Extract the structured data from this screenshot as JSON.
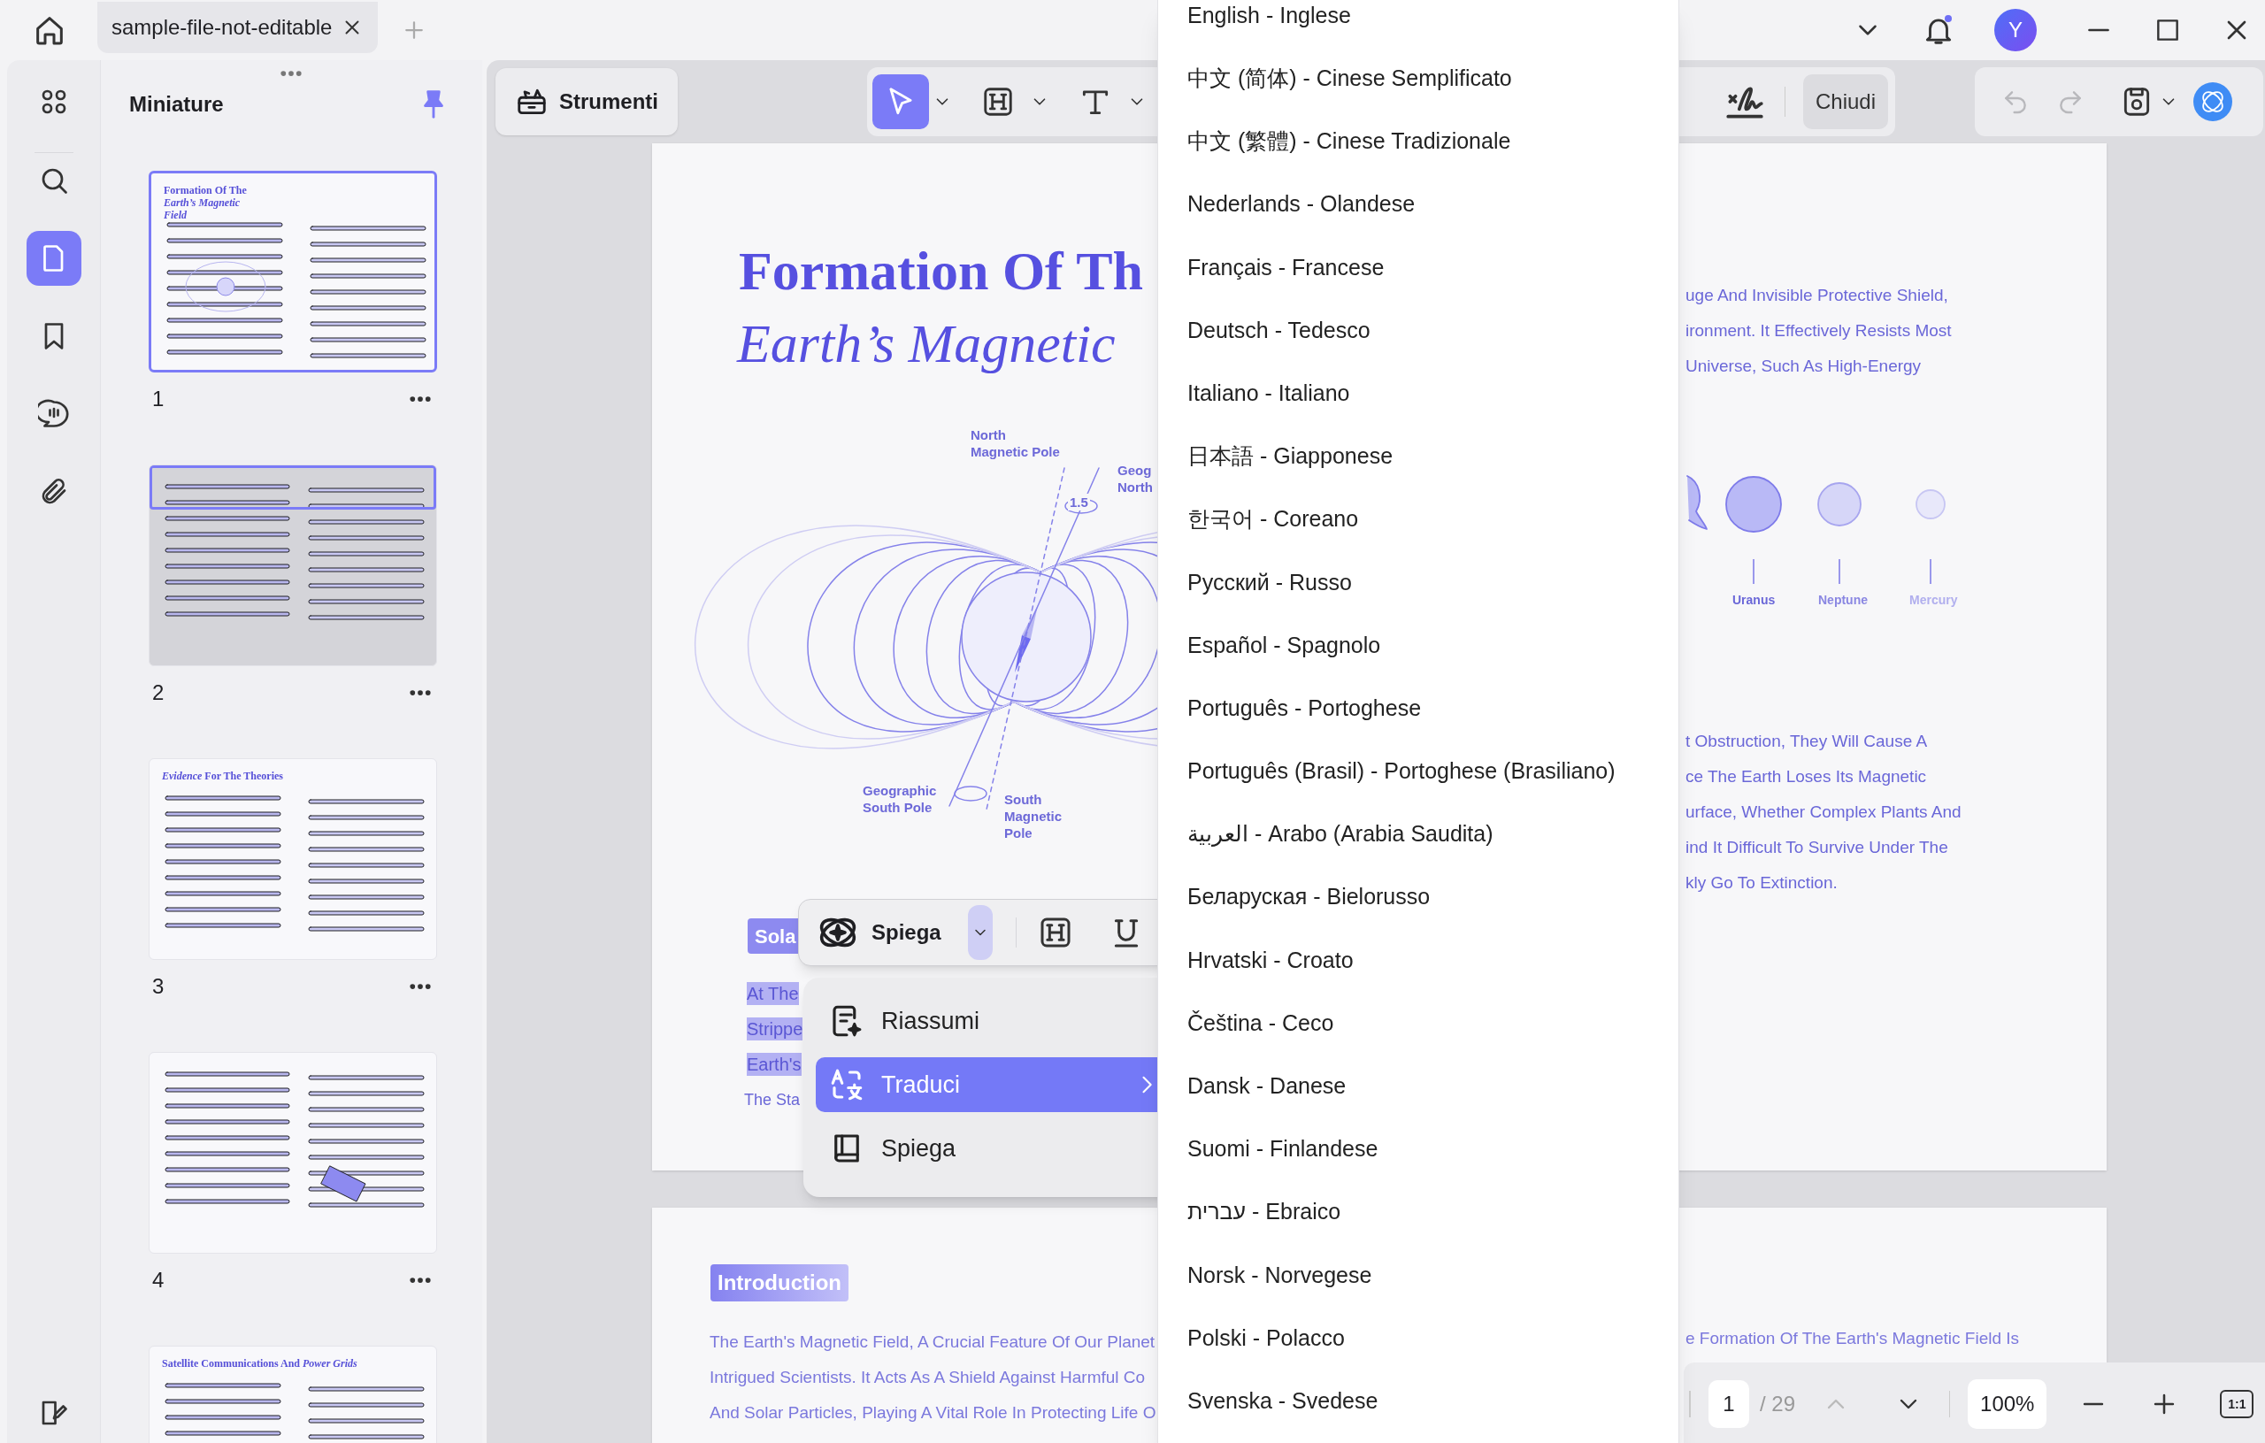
{
  "window": {
    "avatar": "Y",
    "notification": true
  },
  "tabs": [
    {
      "label": "sample-file-not-editable",
      "selected": true
    }
  ],
  "sidebar": {
    "items": [
      {
        "kind": "grid",
        "selected": false
      },
      {
        "kind": "search",
        "selected": false
      },
      {
        "kind": "pages",
        "selected": true
      },
      {
        "kind": "bookmark",
        "selected": false
      },
      {
        "kind": "comment",
        "selected": false
      },
      {
        "kind": "attachment",
        "selected": false
      }
    ]
  },
  "thumbnails_panel": {
    "title": "Miniature",
    "pinned": true,
    "thumbnails": [
      {
        "page": "1",
        "title": "Formation Of The *Earth’s Magnetic Field*",
        "selected": true,
        "in_view": false
      },
      {
        "page": "2",
        "selected": false,
        "in_view": true
      },
      {
        "page": "3",
        "title": "*Evidence* For The Theories",
        "selected": false,
        "in_view": false
      },
      {
        "page": "4",
        "selected": false,
        "in_view": false
      },
      {
        "title": "Satellite Communications And *Power Grids*",
        "selected": false,
        "in_view": false
      }
    ]
  },
  "toolbar": {
    "tools_button": "Strumenti",
    "tools": [
      {
        "kind": "select",
        "selected": true
      },
      {
        "kind": "heading",
        "selected": false
      },
      {
        "kind": "text",
        "selected": false
      }
    ],
    "close_button": "Chiudi",
    "history": [
      {
        "kind": "undo",
        "disabled": true
      },
      {
        "kind": "redo",
        "disabled": true
      }
    ]
  },
  "document": {
    "page1": {
      "title": "Formation Of Th",
      "subtitle": "Earth’s Magnetic",
      "labels": [
        {
          "kind": "north_magnetic",
          "lines": [
            "North",
            "Magnetic Pole"
          ]
        },
        {
          "kind": "angle",
          "lines": [
            "1.5"
          ]
        },
        {
          "kind": "geo_north",
          "lines": [
            "Geog",
            "North"
          ]
        },
        {
          "kind": "geo_south",
          "lines": [
            "Geographic",
            "South Pole"
          ]
        },
        {
          "kind": "south_magnetic",
          "lines": [
            "South",
            "Magnetic",
            "Pole"
          ]
        }
      ],
      "section_badge": "Sola",
      "selected_lines": [
        "At The",
        "Strippe",
        "Earth's"
      ],
      "body_line": "The Sta",
      "right_text_1": [
        "uge And Invisible Protective Shield,",
        "ironment. It Effectively Resists Most",
        "Universe, Such As High-Energy"
      ],
      "planets": [
        {
          "name": "Uranus",
          "color": "#b9b9f6"
        },
        {
          "name": "Neptune",
          "color": "#d6d6f8"
        },
        {
          "name": "Mercury",
          "color": "#e8e8fa"
        }
      ],
      "right_text_2": [
        "t Obstruction, They Will Cause A",
        "ce The Earth Loses Its Magnetic",
        "urface, Whether Complex Plants And",
        "ind It Difficult To Survive Under The",
        "kly Go To Extinction."
      ]
    },
    "page2": {
      "section_badge": "Introduction",
      "lines": [
        "The Earth's Magnetic Field, A Crucial Feature Of Our Planet",
        "Intrigued Scientists. It Acts As A Shield Against Harmful Co",
        "And Solar Particles, Playing A Vital Role In Protecting Life O"
      ],
      "right_line": "e Formation Of The Earth's Magnetic Field Is"
    }
  },
  "ai_toolbar": {
    "label": "Spiega"
  },
  "ai_menu": [
    {
      "kind": "summarize",
      "label": "Riassumi",
      "selected": false,
      "submenu": false
    },
    {
      "kind": "translate",
      "label": "Traduci",
      "selected": true,
      "submenu": true
    },
    {
      "kind": "explain",
      "label": "Spiega",
      "selected": false,
      "submenu": false
    }
  ],
  "language_menu": [
    "English - Inglese",
    "中文 (简体) - Cinese Semplificato",
    "中文 (繁體) - Cinese Tradizionale",
    "Nederlands - Olandese",
    "Français - Francese",
    "Deutsch - Tedesco",
    "Italiano - Italiano",
    "日本語 - Giapponese",
    "한국어 - Coreano",
    "Русский - Russo",
    "Español - Spagnolo",
    "Português - Portoghese",
    "Português (Brasil) - Portoghese (Brasiliano)",
    "العربية - Arabo (Arabia Saudita)",
    "Беларуская - Bielorusso",
    "Hrvatski - Croato",
    "Čeština - Ceco",
    "Dansk - Danese",
    "Suomi - Finlandese",
    "עברית - Ebraico",
    "Norsk - Norvegese",
    "Polski - Polacco",
    "Svenska - Svedese"
  ],
  "page_nav": {
    "page": "1",
    "total": "/ 29",
    "prev_disabled": true,
    "zoom": "100%",
    "fit": "1:1"
  }
}
